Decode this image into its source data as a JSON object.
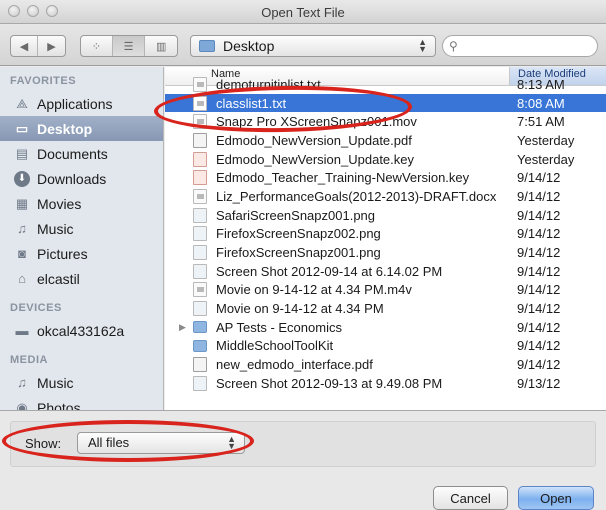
{
  "window": {
    "title": "Open Text File"
  },
  "toolbar": {
    "location": "Desktop",
    "view_icons": [
      "icon-view-icon",
      "list-view-icon",
      "column-view-icon"
    ]
  },
  "sidebar": {
    "sections": [
      {
        "heading": "FAVORITES",
        "items": [
          {
            "label": "Applications",
            "icon": "applications-icon"
          },
          {
            "label": "Desktop",
            "icon": "desktop-icon",
            "selected": true
          },
          {
            "label": "Documents",
            "icon": "documents-icon"
          },
          {
            "label": "Downloads",
            "icon": "downloads-icon"
          },
          {
            "label": "Movies",
            "icon": "movies-icon"
          },
          {
            "label": "Music",
            "icon": "music-icon"
          },
          {
            "label": "Pictures",
            "icon": "pictures-icon"
          },
          {
            "label": "elcastil",
            "icon": "home-icon"
          }
        ]
      },
      {
        "heading": "DEVICES",
        "items": [
          {
            "label": "okcal433162a",
            "icon": "computer-icon"
          }
        ]
      },
      {
        "heading": "MEDIA",
        "items": [
          {
            "label": "Music",
            "icon": "music-icon"
          },
          {
            "label": "Photos",
            "icon": "camera-icon"
          }
        ]
      }
    ]
  },
  "file_list": {
    "columns": {
      "name": "Name",
      "date": "Date Modified"
    },
    "rows": [
      {
        "name": "demoturnitinlist.txt",
        "date": "8:13 AM",
        "kind": "doc",
        "partial": "top"
      },
      {
        "name": "classlist1.txt",
        "date": "8:08 AM",
        "kind": "doc",
        "selected": true
      },
      {
        "name": "Snapz Pro XScreenSnapz001.mov",
        "date": "7:51 AM",
        "kind": "doc",
        "partial": "bottom"
      },
      {
        "name": "Edmodo_NewVersion_Update.pdf",
        "date": "Yesterday",
        "kind": "pdf"
      },
      {
        "name": "Edmodo_NewVersion_Update.key",
        "date": "Yesterday",
        "kind": "key"
      },
      {
        "name": "Edmodo_Teacher_Training-NewVersion.key",
        "date": "9/14/12",
        "kind": "key"
      },
      {
        "name": "Liz_PerformanceGoals(2012-2013)-DRAFT.docx",
        "date": "9/14/12",
        "kind": "doc"
      },
      {
        "name": "SafariScreenSnapz001.png",
        "date": "9/14/12",
        "kind": "img"
      },
      {
        "name": "FirefoxScreenSnapz002.png",
        "date": "9/14/12",
        "kind": "img"
      },
      {
        "name": "FirefoxScreenSnapz001.png",
        "date": "9/14/12",
        "kind": "img"
      },
      {
        "name": "Screen Shot 2012-09-14 at 6.14.02 PM",
        "date": "9/14/12",
        "kind": "img"
      },
      {
        "name": "Movie on 9-14-12 at 4.34 PM.m4v",
        "date": "9/14/12",
        "kind": "doc"
      },
      {
        "name": "Movie on 9-14-12 at 4.34 PM",
        "date": "9/14/12",
        "kind": "img"
      },
      {
        "name": "AP Tests - Economics",
        "date": "9/14/12",
        "kind": "folder",
        "disclosure": true
      },
      {
        "name": "MiddleSchoolToolKit",
        "date": "9/14/12",
        "kind": "folder"
      },
      {
        "name": "new_edmodo_interface.pdf",
        "date": "9/14/12",
        "kind": "pdf"
      },
      {
        "name": "Screen Shot 2012-09-13 at 9.49.08 PM",
        "date": "9/13/12",
        "kind": "img",
        "partial": "cut"
      }
    ]
  },
  "show": {
    "label": "Show:",
    "value": "All files"
  },
  "buttons": {
    "cancel": "Cancel",
    "open": "Open"
  },
  "colors": {
    "selection": "#3875d7",
    "annotation": "#d8241c",
    "sidebar_selection": "#8798b4"
  }
}
